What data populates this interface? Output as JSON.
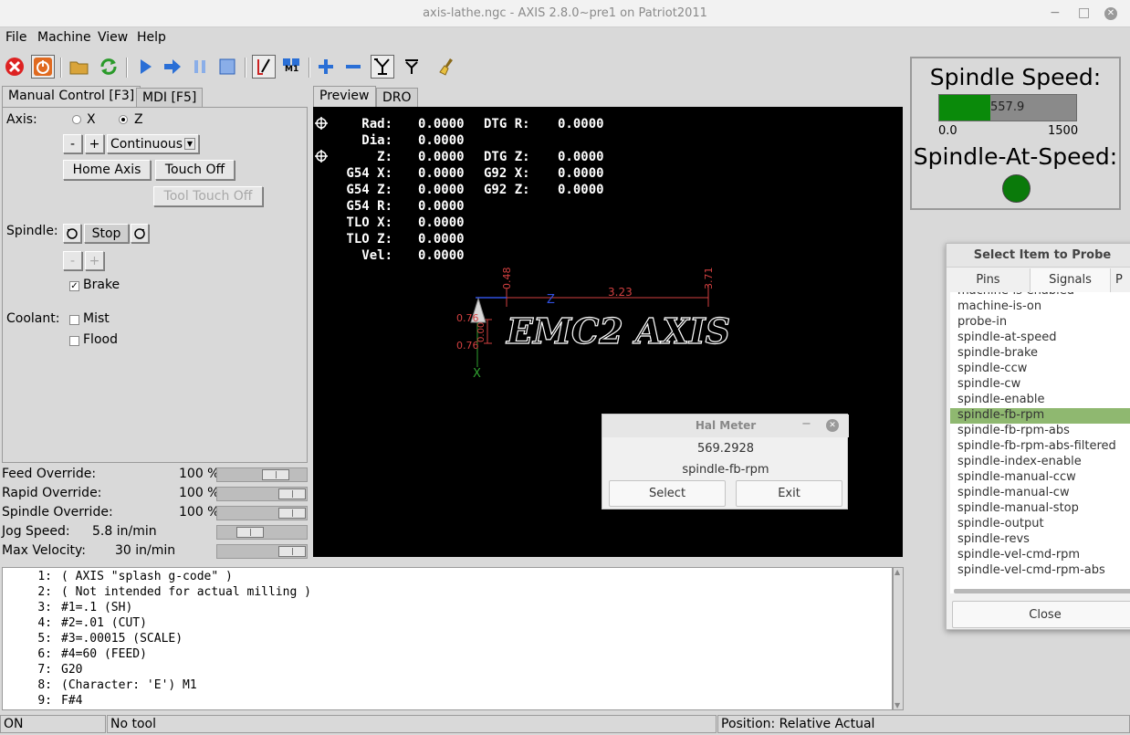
{
  "window": {
    "title": "axis-lathe.ngc - AXIS 2.8.0~pre1 on Patriot2011"
  },
  "menu": {
    "file": "File",
    "machine": "Machine",
    "view": "View",
    "help": "Help"
  },
  "toolbar": {
    "icons": [
      "estop-icon",
      "power-icon",
      "open-folder-icon",
      "reload-icon",
      "run-icon",
      "step-icon",
      "pause-icon",
      "stop-icon",
      "toggle-skip-icon",
      "mdi-icon",
      "zoom-in-icon",
      "zoom-out-icon",
      "view-y-icon",
      "view-y-rotated-icon",
      "clear-plot-icon"
    ],
    "mdi_label": "M1"
  },
  "left_tabs": {
    "manual": "Manual Control [F3]",
    "mdi": "MDI [F5]"
  },
  "manual": {
    "axis_label": "Axis:",
    "axis_x": "X",
    "axis_z": "Z",
    "selected_axis": "Z",
    "minus": "-",
    "plus": "+",
    "jog_mode": "Continuous",
    "home_axis": "Home Axis",
    "touch_off": "Touch Off",
    "tool_touch_off": "Tool Touch Off",
    "spindle_label": "Spindle:",
    "spindle_stop": "Stop",
    "brake": "Brake",
    "brake_checked": true,
    "coolant_label": "Coolant:",
    "mist": "Mist",
    "flood": "Flood"
  },
  "overrides": [
    {
      "label": "Feed Override:",
      "value": "100 %",
      "fraction": 0.73
    },
    {
      "label": "Rapid Override:",
      "value": "100 %",
      "fraction": 1.0
    },
    {
      "label": "Spindle Override:",
      "value": "100 %",
      "fraction": 1.0
    },
    {
      "label": "Jog Speed:",
      "value": "5.8 in/min",
      "fraction": 0.3
    },
    {
      "label": "Max Velocity:",
      "value": "30 in/min",
      "fraction": 1.0
    }
  ],
  "preview_tabs": {
    "preview": "Preview",
    "dro": "DRO"
  },
  "dro": {
    "rows": [
      {
        "label": "Rad:",
        "value": "0.0000",
        "label2": "DTG R:",
        "value2": "0.0000"
      },
      {
        "label": "Dia:",
        "value": "0.0000",
        "label2": "",
        "value2": ""
      },
      {
        "label": "Z:",
        "value": "0.0000",
        "label2": "DTG Z:",
        "value2": "0.0000"
      },
      {
        "label": "G54 X:",
        "value": "0.0000",
        "label2": "G92 X:",
        "value2": "0.0000"
      },
      {
        "label": "G54 Z:",
        "value": "0.0000",
        "label2": "G92 Z:",
        "value2": "0.0000"
      },
      {
        "label": "G54 R:",
        "value": "0.0000",
        "label2": "",
        "value2": ""
      },
      {
        "label": "TLO X:",
        "value": "0.0000",
        "label2": "",
        "value2": ""
      },
      {
        "label": "TLO Z:",
        "value": "0.0000",
        "label2": "",
        "value2": ""
      },
      {
        "label": "Vel:",
        "value": "0.0000",
        "label2": "",
        "value2": ""
      }
    ]
  },
  "plot": {
    "text": "EMC2 AXIS",
    "dim_z": "3.23",
    "dim_left": "0.48",
    "dim_right": "3.71",
    "dim_x1": "0.76",
    "dim_x2": "0.76",
    "dim_x3": "0.00",
    "axis_z": "Z",
    "axis_x": "X"
  },
  "gcode": [
    {
      "n": "1:",
      "text": "( AXIS \"splash g-code\" )"
    },
    {
      "n": "2:",
      "text": "( Not intended for actual milling )"
    },
    {
      "n": "3:",
      "text": "#1=.1 (SH)"
    },
    {
      "n": "4:",
      "text": "#2=.01 (CUT)"
    },
    {
      "n": "5:",
      "text": "#3=.00015 (SCALE)"
    },
    {
      "n": "6:",
      "text": "#4=60 (FEED)"
    },
    {
      "n": "7:",
      "text": "G20"
    },
    {
      "n": "8:",
      "text": "(Character: 'E') M1"
    },
    {
      "n": "9:",
      "text": "F#4"
    }
  ],
  "status": {
    "state": "ON",
    "tool": "No tool",
    "position": "Position: Relative Actual"
  },
  "pyvcp": {
    "spindle_speed_label": "Spindle Speed:",
    "bar_value": "557.9",
    "bar_fraction": 0.372,
    "bar_min": "0.0",
    "bar_max": "1500",
    "at_speed_label": "Spindle-At-Speed:",
    "led_color": "#0a7a0a"
  },
  "probe": {
    "title": "Select Item to Probe",
    "tabs": [
      "Pins",
      "Signals",
      "P"
    ],
    "active_tab": "Signals",
    "signals": [
      "machine-is-enabled",
      "machine-is-on",
      "probe-in",
      "spindle-at-speed",
      "spindle-brake",
      "spindle-ccw",
      "spindle-cw",
      "spindle-enable",
      "spindle-fb-rpm",
      "spindle-fb-rpm-abs",
      "spindle-fb-rpm-abs-filtered",
      "spindle-index-enable",
      "spindle-manual-ccw",
      "spindle-manual-cw",
      "spindle-manual-stop",
      "spindle-output",
      "spindle-revs",
      "spindle-vel-cmd-rpm",
      "spindle-vel-cmd-rpm-abs"
    ],
    "selected": "spindle-fb-rpm",
    "close": "Close"
  },
  "halmeter": {
    "title": "Hal Meter",
    "value": "569.2928",
    "signal": "spindle-fb-rpm",
    "select": "Select",
    "exit": "Exit"
  }
}
